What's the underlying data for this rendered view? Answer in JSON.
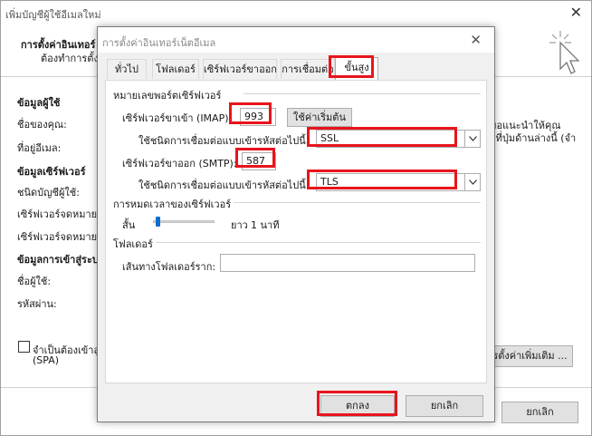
{
  "background_window": {
    "title": "เพิ่มบัญชีผู้ใช้อีเมลใหม่",
    "header_title": "การตั้งค่าอินเทอร์",
    "header_sub": "ต้องทำการตั้งค่",
    "left_labels": [
      {
        "text": "ข้อมูลผู้ใช้",
        "bold": true
      },
      {
        "text": "ชื่อของคุณ:",
        "bold": false
      },
      {
        "text": "ที่อยู่อีเมล:",
        "bold": false
      },
      {
        "text": "ข้อมูลเซิร์ฟเวอร์",
        "bold": true
      },
      {
        "text": "ชนิดบัญชีผู้ใช้:",
        "bold": false
      },
      {
        "text": "เซิร์ฟเวอร์จดหมายข",
        "bold": false
      },
      {
        "text": "เซิร์ฟเวอร์จดหมายข",
        "bold": false
      },
      {
        "text": "ข้อมูลการเข้าสู่ระบ",
        "bold": true
      },
      {
        "text": "ชื่อผู้ใช้:",
        "bold": false
      },
      {
        "text": "รหัสผ่าน:",
        "bold": false
      }
    ],
    "right_text_1": "ขอแนะนำให้คุณ",
    "right_text_2": "กที่ปุ่มด้านล่างนี้ (จำ",
    "spa_label_1": "จำเป็นต้องเข้าสู่",
    "spa_label_2": "(SPA)",
    "more_settings_button": "รตั้งค่าเพิ่มเติม ...",
    "cancel_button": "ยกเลิก"
  },
  "dialog": {
    "title": "การตั้งค่าอินเทอร์เน็ตอีเมล",
    "tabs": [
      "ทั่วไป",
      "โฟลเดอร์",
      "เซิร์ฟเวอร์ขาออก",
      "การเชื่อมต่อ",
      "ขั้นสูง"
    ],
    "active_tab": "ขั้นสูง",
    "ports_group": "หมายเลขพอร์ตเซิร์ฟเวอร์",
    "incoming_label": "เซิร์ฟเวอร์ขาเข้า (IMAP):",
    "incoming_port": "993",
    "use_defaults_button": "ใช้ค่าเริ่มต้น",
    "incoming_encryption_label": "ใช้ชนิดการเชื่อมต่อแบบเข้ารหัสต่อไปนี้:",
    "incoming_encryption_value": "SSL",
    "outgoing_label": "เซิร์ฟเวอร์ขาออก (SMTP):",
    "outgoing_port": "587",
    "outgoing_encryption_label": "ใช้ชนิดการเชื่อมต่อแบบเข้ารหัสต่อไปนี้:",
    "outgoing_encryption_value": "TLS",
    "timeout_group": "การหมดเวลาของเซิร์ฟเวอร์",
    "timeout_short": "สั้น",
    "timeout_long": "ยาว",
    "timeout_value": "1 นาที",
    "timeout_level": 0.05,
    "folders_group": "โฟลเดอร์",
    "root_folder_label": "เส้นทางโฟลเดอร์ราก:",
    "root_folder_value": "",
    "ok_button": "ตกลง",
    "cancel_button": "ยกเลิก"
  },
  "highlight_color": "#e8141c",
  "accent_color": "#0a6ed1"
}
